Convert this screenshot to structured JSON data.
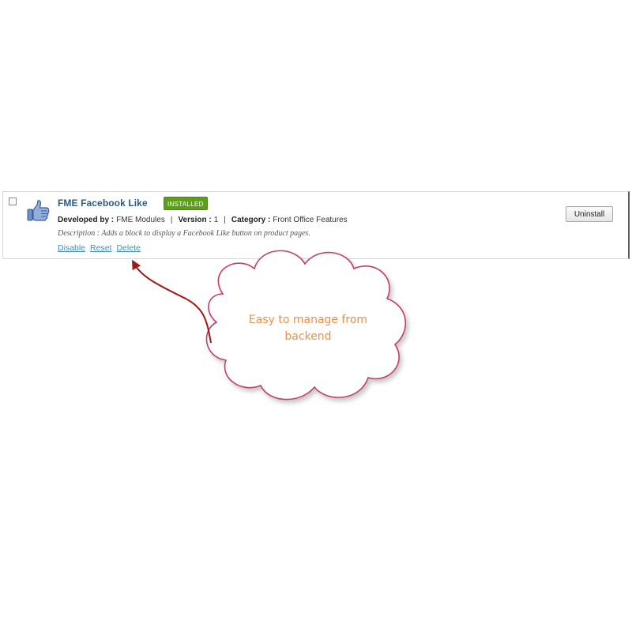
{
  "module": {
    "title": "FME Facebook Like",
    "status_badge": "INSTALLED",
    "developed_by_label": "Developed by :",
    "developed_by_value": "FME Modules",
    "version_label": "Version :",
    "version_value": "1",
    "category_label": "Category :",
    "category_value": "Front Office Features",
    "separator": "|",
    "description": "Description : Adds a block to display a Facebook Like button on product pages.",
    "actions": {
      "disable": "Disable",
      "reset": "Reset",
      "delete": "Delete"
    },
    "uninstall_label": "Uninstall",
    "icon": "thumbs-up-icon",
    "checkbox_checked": false
  },
  "callout": {
    "text": "Easy to manage from backend"
  },
  "colors": {
    "title": "#2a5a84",
    "badge": "#5d9e1a",
    "link": "#3d8fb4",
    "cloud_border": "#c0406a",
    "arrow": "#a01818",
    "callout_text": "#e8904a"
  }
}
